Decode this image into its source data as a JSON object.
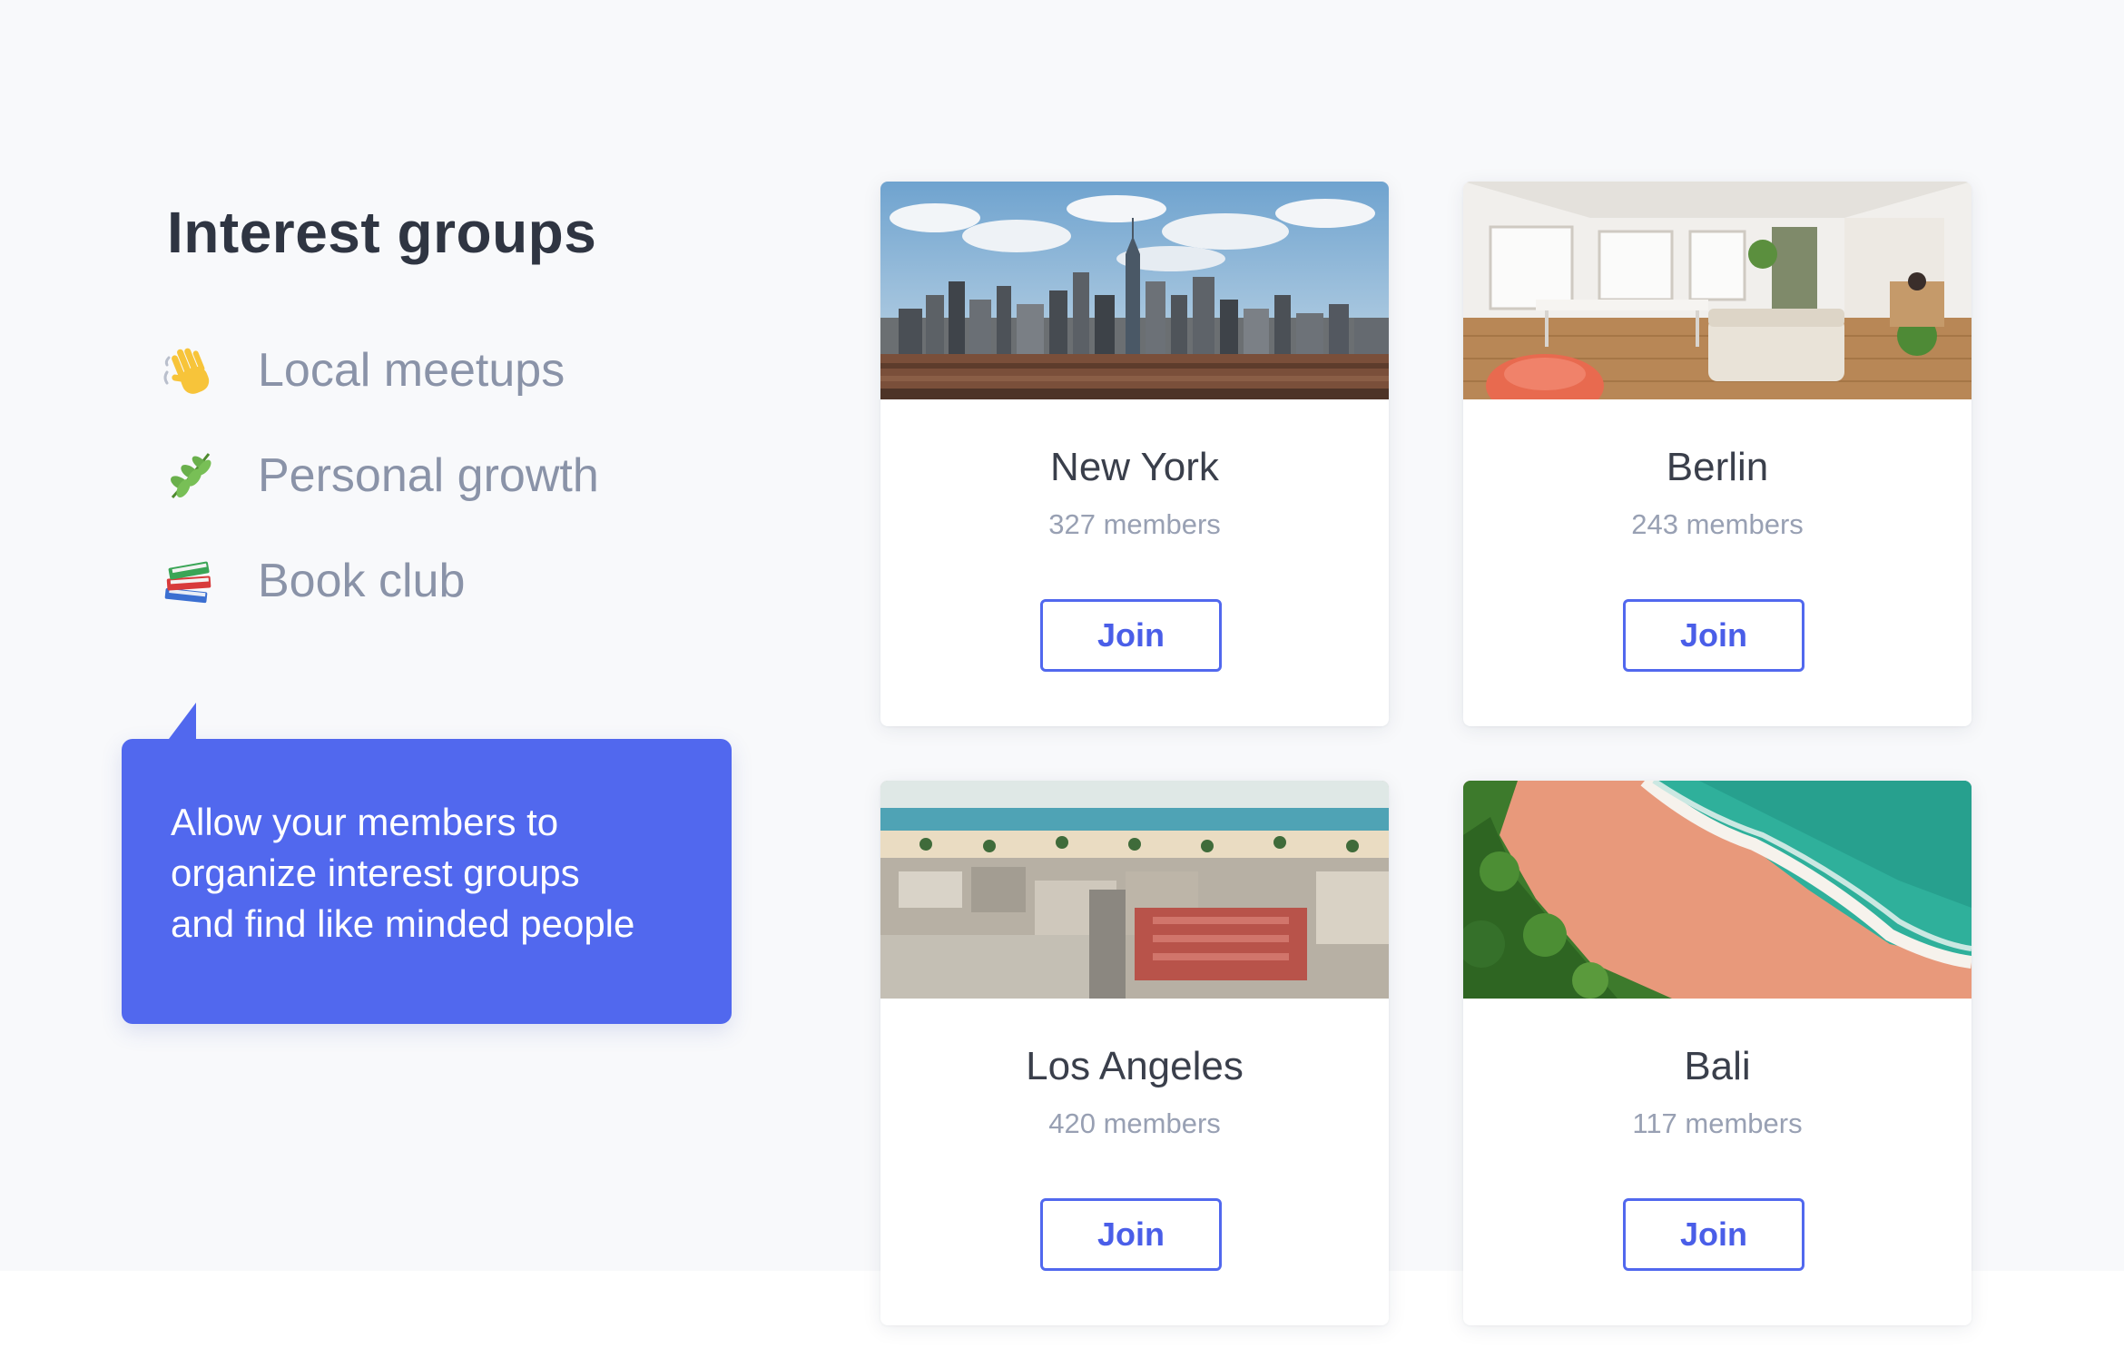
{
  "sidebar": {
    "title": "Interest groups",
    "topics": [
      {
        "label": "Local meetups",
        "icon": "waving-hand-icon"
      },
      {
        "label": "Personal growth",
        "icon": "herb-icon"
      },
      {
        "label": "Book club",
        "icon": "books-icon"
      }
    ]
  },
  "callout": {
    "line1": "Allow your members to",
    "line2": "organize interest groups",
    "line3": "and find like minded people"
  },
  "groups": [
    {
      "name": "New York",
      "members": "327 members",
      "join_label": "Join",
      "photo": "city-skyline-photo"
    },
    {
      "name": "Berlin",
      "members": "243 members",
      "join_label": "Join",
      "photo": "coworking-space-photo"
    },
    {
      "name": "Los Angeles",
      "members": "420 members",
      "join_label": "Join",
      "photo": "beach-city-aerial-photo"
    },
    {
      "name": "Bali",
      "members": "117 members",
      "join_label": "Join",
      "photo": "tropical-beach-aerial-photo"
    }
  ],
  "colors": {
    "accent": "#5168ee",
    "heading": "#2f3542",
    "muted": "#8a93a8",
    "background": "#f8f9fb"
  }
}
